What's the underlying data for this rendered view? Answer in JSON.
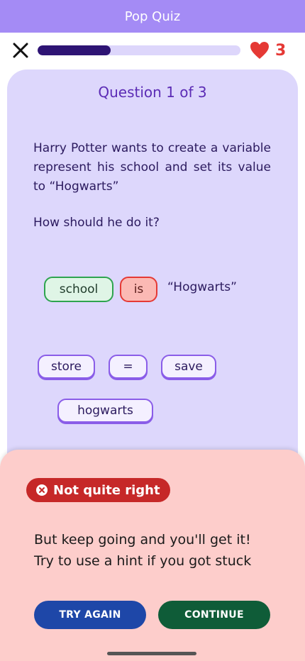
{
  "app": {
    "title": "Pop Quiz"
  },
  "header": {
    "close_icon": "close-icon",
    "progress_fraction": 0.36,
    "lives_icon": "heart-icon",
    "lives_count": "3"
  },
  "question": {
    "title": "Question 1 of 3",
    "text": "Harry Potter wants to create a variable represent his school and set its value to “Hogwarts”",
    "prompt": "How should he do it?"
  },
  "answer": {
    "chips": [
      "school",
      "is"
    ],
    "literal": "“Hogwarts”"
  },
  "options": [
    "store",
    "=",
    "save",
    "hogwarts"
  ],
  "feedback": {
    "status_icon": "error-icon",
    "status": "Not quite right",
    "line1": "But keep going and you'll get it!",
    "line2": "Try to use a hint if you got stuck"
  },
  "actions": {
    "try_again": "TRY AGAIN",
    "continue": "CONTINUE"
  },
  "colors": {
    "accent": "#a48bf5",
    "correct": "#2ea44f",
    "wrong": "#e53935",
    "try_again": "#1e47a8",
    "continue": "#0f5c38"
  }
}
